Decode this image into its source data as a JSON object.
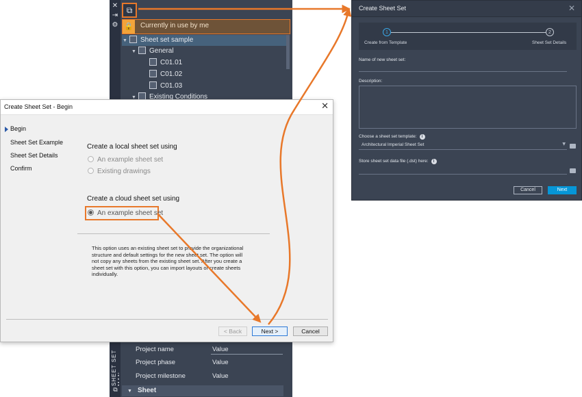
{
  "colors": {
    "accent_orange": "#e8782a",
    "dark_panel": "#3b4453",
    "primary_blue": "#0696d7"
  },
  "sheet_set_manager": {
    "in_use_text": "Currently in use by me",
    "tree": [
      {
        "label": "Sheet set sample"
      },
      {
        "label": "General"
      },
      {
        "label": "C01.01"
      },
      {
        "label": "C01.02"
      },
      {
        "label": "C01.03"
      },
      {
        "label": "Existing Conditions"
      }
    ],
    "strip_label": "SHEET SET MAN",
    "properties": [
      {
        "name": "Project name",
        "value": "Value"
      },
      {
        "name": "Project phase",
        "value": "Value"
      },
      {
        "name": "Project milestone",
        "value": "Value"
      }
    ],
    "group_label": "Sheet",
    "icons": [
      "close-icon",
      "pin-icon",
      "gear-icon",
      "sheet-set-icon",
      "lock-icon"
    ]
  },
  "classic_dialog": {
    "title": "Create Sheet Set - Begin",
    "nav": [
      "Begin",
      "Sheet Set Example",
      "Sheet Set Details",
      "Confirm"
    ],
    "local_heading": "Create a local sheet set using",
    "local_options": [
      "An example sheet set",
      "Existing drawings"
    ],
    "cloud_heading": "Create a cloud sheet set using",
    "cloud_option": "An example sheet set",
    "description": "This option uses an existing sheet set to provide the organizational structure and default settings for the new sheet set.  The option will not copy any sheets from the existing sheet set.  After you create a sheet set with this option, you can import layouts or create sheets individually.",
    "buttons": {
      "back": "< Back",
      "next": "Next >",
      "cancel": "Cancel"
    }
  },
  "modern_dialog": {
    "title": "Create Sheet Set",
    "steps": [
      {
        "number": "1",
        "label": "Create from Template"
      },
      {
        "number": "2",
        "label": "Sheet Set Details"
      }
    ],
    "name_label": "Name of new sheet set:",
    "name_value": "",
    "description_label": "Description:",
    "description_value": "",
    "template_label": "Choose a sheet set template:",
    "template_value": "Architectural Imperial Sheet Set",
    "store_label": "Store sheet set data file (.dst) here:",
    "store_value": "",
    "buttons": {
      "cancel": "Cancel",
      "next": "Next"
    }
  }
}
